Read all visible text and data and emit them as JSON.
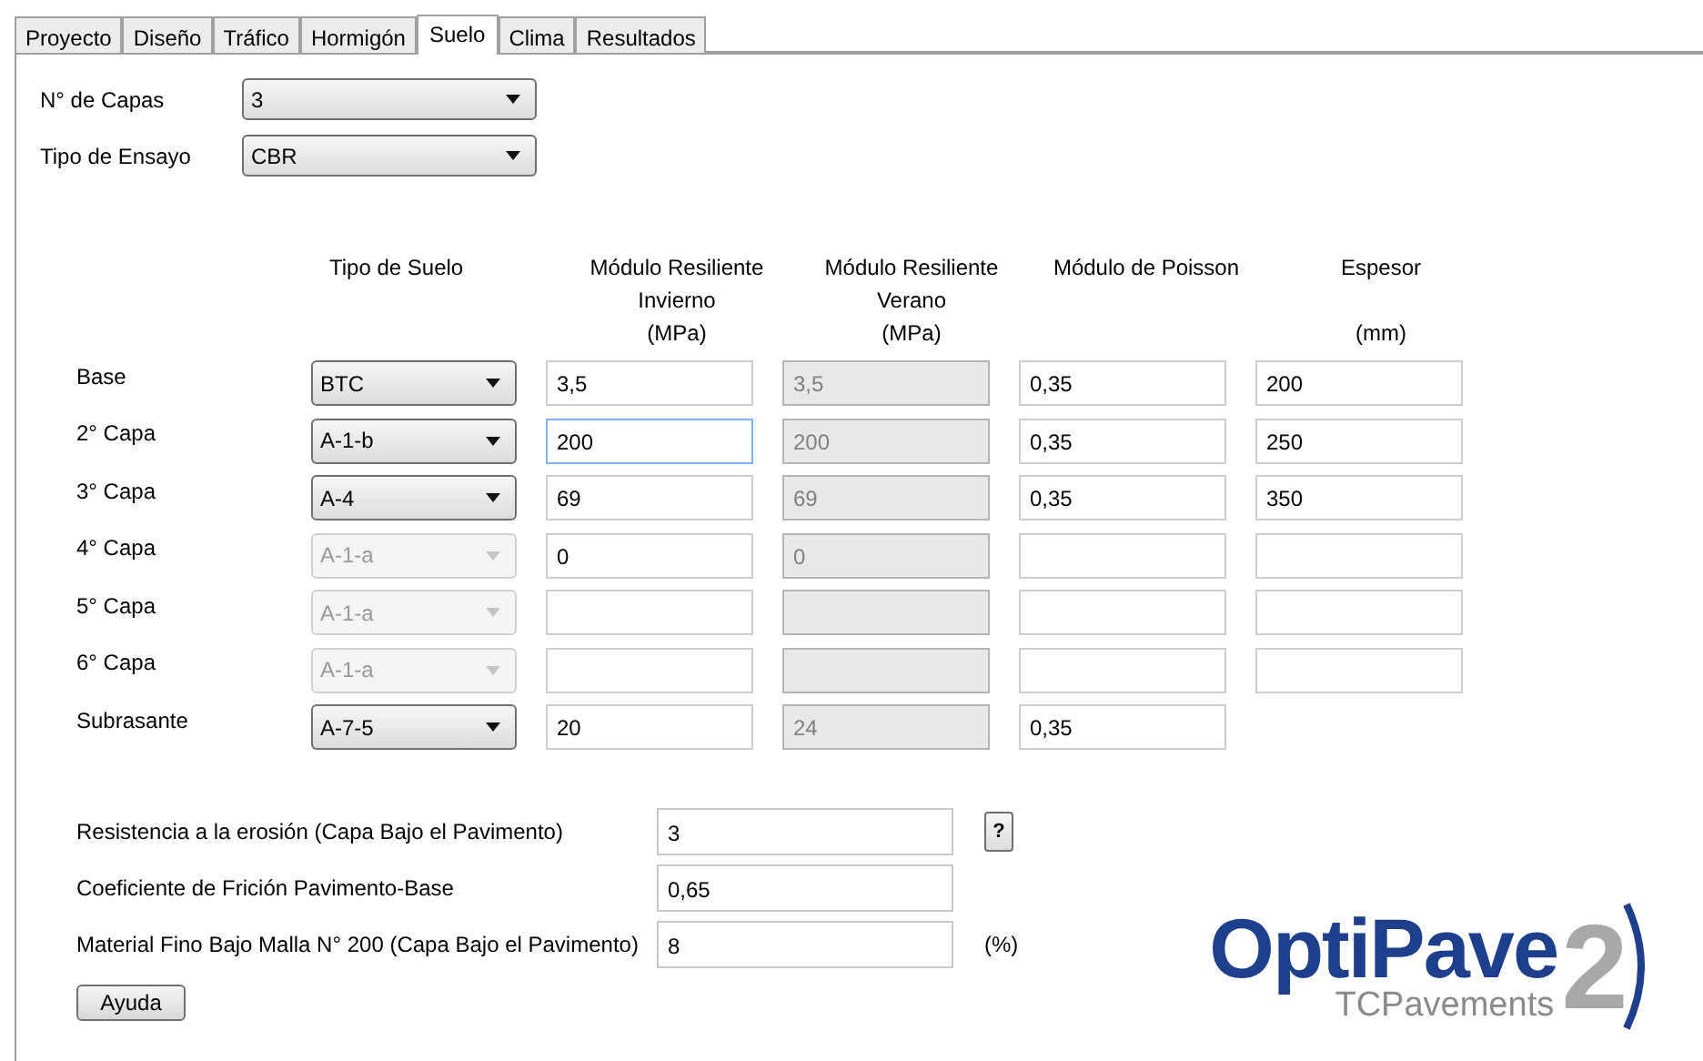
{
  "tabs": [
    {
      "label": "Proyecto",
      "selected": false
    },
    {
      "label": "Diseño",
      "selected": false
    },
    {
      "label": "Tráfico",
      "selected": false
    },
    {
      "label": "Hormigón",
      "selected": false
    },
    {
      "label": "Suelo",
      "selected": true
    },
    {
      "label": "Clima",
      "selected": false
    },
    {
      "label": "Resultados",
      "selected": false
    }
  ],
  "settings": [
    {
      "label": "N° de Capas",
      "value": "3"
    },
    {
      "label": "Tipo de Ensayo",
      "value": "CBR"
    }
  ],
  "columns": [
    "Tipo de Suelo",
    "Módulo Resiliente\nInvierno\n(MPa)",
    "Módulo Resiliente\nVerano\n(MPa)",
    "Módulo de Poisson",
    "Espesor\n\n(mm)"
  ],
  "layers": [
    {
      "label": "Base",
      "soil": {
        "value": "BTC",
        "disabled": false
      },
      "fields": [
        {
          "value": "3,5",
          "disabled": false,
          "focused": false
        },
        {
          "value": "3,5",
          "disabled": true,
          "focused": false
        },
        {
          "value": "0,35",
          "disabled": false,
          "focused": false
        },
        {
          "value": "200",
          "disabled": false,
          "focused": false
        }
      ]
    },
    {
      "label": "2° Capa",
      "soil": {
        "value": "A-1-b",
        "disabled": false
      },
      "fields": [
        {
          "value": "200",
          "disabled": false,
          "focused": true
        },
        {
          "value": "200",
          "disabled": true,
          "focused": false
        },
        {
          "value": "0,35",
          "disabled": false,
          "focused": false
        },
        {
          "value": "250",
          "disabled": false,
          "focused": false
        }
      ]
    },
    {
      "label": "3° Capa",
      "soil": {
        "value": "A-4",
        "disabled": false
      },
      "fields": [
        {
          "value": "69",
          "disabled": false,
          "focused": false
        },
        {
          "value": "69",
          "disabled": true,
          "focused": false
        },
        {
          "value": "0,35",
          "disabled": false,
          "focused": false
        },
        {
          "value": "350",
          "disabled": false,
          "focused": false
        }
      ]
    },
    {
      "label": "4° Capa",
      "soil": {
        "value": "A-1-a",
        "disabled": true
      },
      "fields": [
        {
          "value": "0",
          "disabled": false,
          "focused": false
        },
        {
          "value": "0",
          "disabled": true,
          "focused": false
        },
        {
          "disabled": false,
          "focused": false
        },
        {
          "disabled": false,
          "focused": false
        }
      ]
    },
    {
      "label": "5° Capa",
      "soil": {
        "value": "A-1-a",
        "disabled": true
      },
      "fields": [
        {
          "disabled": false,
          "focused": false
        },
        {
          "disabled": true,
          "focused": false
        },
        {
          "disabled": false,
          "focused": false
        },
        {
          "disabled": false,
          "focused": false
        }
      ]
    },
    {
      "label": "6° Capa",
      "soil": {
        "value": "A-1-a",
        "disabled": true
      },
      "fields": [
        {
          "disabled": false,
          "focused": false
        },
        {
          "disabled": true,
          "focused": false
        },
        {
          "disabled": false,
          "focused": false
        },
        {
          "disabled": false,
          "focused": false
        }
      ]
    },
    {
      "label": "Subrasante",
      "soil": {
        "value": "A-7-5",
        "disabled": false
      },
      "fields": [
        {
          "value": "20",
          "disabled": false,
          "focused": false
        },
        {
          "value": "24",
          "disabled": true,
          "focused": false
        },
        {
          "value": "0,35",
          "disabled": false,
          "focused": false
        }
      ]
    }
  ],
  "properties": [
    {
      "label": "Resistencia a la erosión (Capa Bajo el Pavimento)",
      "value": "3",
      "help": "?"
    },
    {
      "label": "Coeficiente de Frición Pavimento-Base",
      "value": "0,65"
    },
    {
      "label": "Material Fino Bajo Malla N° 200 (Capa Bajo el Pavimento)",
      "value": "8",
      "unit": "(%)"
    }
  ],
  "help_button": "Ayuda",
  "logo": {
    "name": "OptiPave",
    "number": "2",
    "company": "TCPavements"
  }
}
